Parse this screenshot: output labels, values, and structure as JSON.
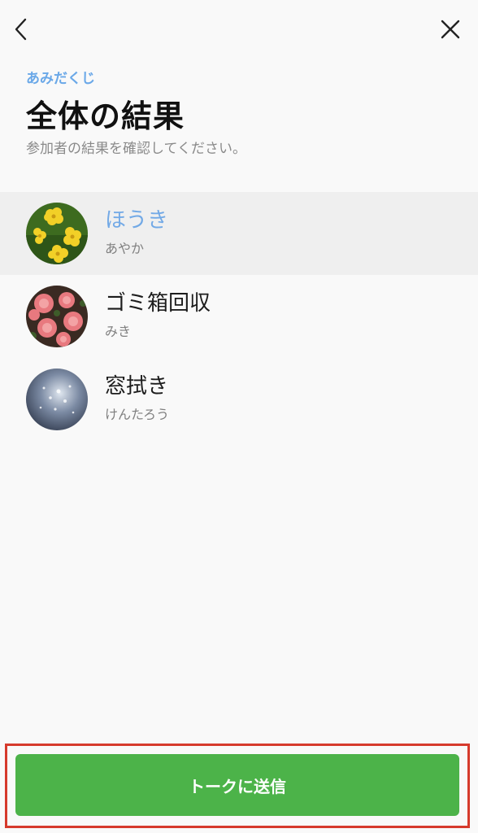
{
  "header": {
    "back_icon": "chevron-left-icon",
    "close_icon": "close-icon"
  },
  "intro": {
    "app_label": "あみだくじ",
    "title": "全体の結果",
    "description": "参加者の結果を確認してください。"
  },
  "results": [
    {
      "task": "ほうき",
      "name": "あやか",
      "avatar": "yellow-flowers",
      "selected": true
    },
    {
      "task": "ゴミ箱回収",
      "name": "みき",
      "avatar": "pink-roses",
      "selected": false
    },
    {
      "task": "窓拭き",
      "name": "けんたろう",
      "avatar": "water-droplets",
      "selected": false
    }
  ],
  "footer": {
    "send_label": "トークに送信"
  },
  "colors": {
    "accent_blue": "#6aa8e8",
    "button_green": "#4cb349",
    "highlight_border": "#d63a2c"
  }
}
